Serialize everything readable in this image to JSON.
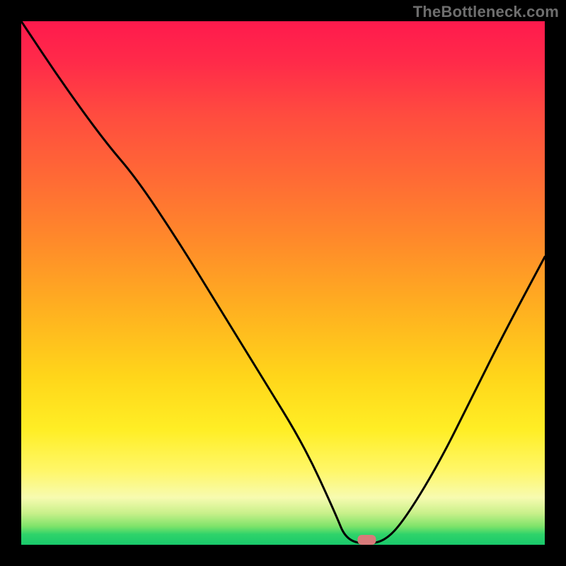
{
  "watermark": "TheBottleneck.com",
  "marker": {
    "x_pct": 66,
    "y_pct": 0
  },
  "chart_data": {
    "type": "line",
    "title": "",
    "xlabel": "",
    "ylabel": "",
    "xlim": [
      0,
      100
    ],
    "ylim": [
      0,
      100
    ],
    "grid": false,
    "legend": false,
    "annotations": [],
    "series": [
      {
        "name": "bottleneck-curve",
        "x": [
          0,
          8,
          16,
          22,
          30,
          38,
          46,
          54,
          60,
          62,
          66,
          70,
          74,
          80,
          86,
          92,
          100
        ],
        "y": [
          100,
          88,
          77,
          70,
          58,
          45,
          32,
          19,
          6,
          1,
          0,
          1,
          6,
          16,
          28,
          40,
          55
        ]
      }
    ],
    "optimum_point": {
      "x": 66,
      "y": 0
    },
    "background_gradient": {
      "orientation": "vertical",
      "stops": [
        {
          "pct": 0,
          "color": "#ff1a4d"
        },
        {
          "pct": 30,
          "color": "#ff6a35"
        },
        {
          "pct": 68,
          "color": "#ffd61a"
        },
        {
          "pct": 91,
          "color": "#f7fbb0"
        },
        {
          "pct": 100,
          "color": "#19c96b"
        }
      ]
    }
  }
}
